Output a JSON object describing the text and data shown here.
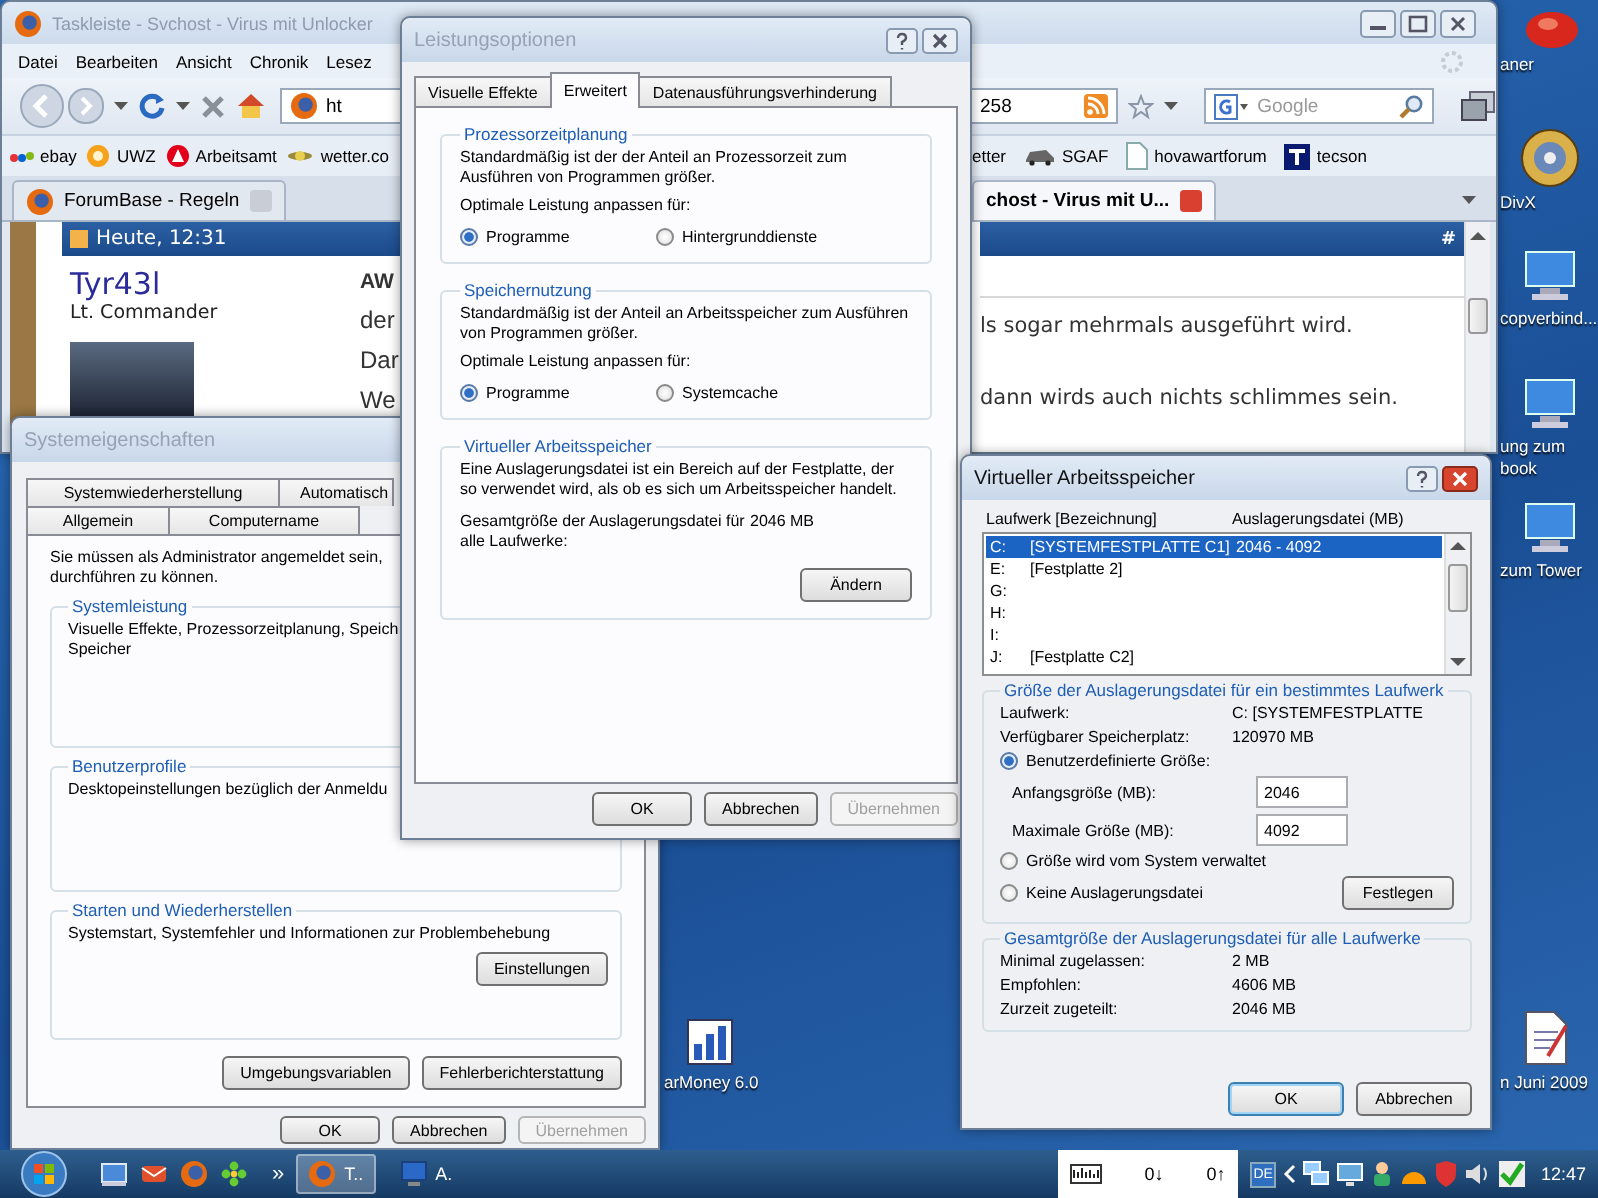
{
  "desktop": {
    "icons": [
      {
        "label": "aner",
        "kind": "red"
      },
      {
        "label": "DivX",
        "kind": "disc"
      },
      {
        "label": "copverbind...",
        "kind": "computer"
      },
      {
        "label": "ung zum book",
        "kind": "computer"
      },
      {
        "label": "zum Tower",
        "kind": "computer"
      },
      {
        "label": "arMoney 6.0",
        "kind": "chart"
      },
      {
        "label": "n Juni 2009",
        "kind": "document"
      }
    ]
  },
  "browser": {
    "title": "Taskleiste - Svchost - Virus mit Unlocker",
    "menu": [
      "Datei",
      "Bearbeiten",
      "Ansicht",
      "Chronik",
      "Lesez"
    ],
    "address_start": "ht",
    "address_end": "258",
    "search": {
      "placeholder": "Google"
    },
    "bookmarks_left": [
      {
        "label": "ebay",
        "kind": "ebay"
      },
      {
        "label": "UWZ",
        "kind": "circle"
      },
      {
        "label": "Arbeitsamt",
        "kind": "red-logo"
      },
      {
        "label": "wetter.co",
        "kind": "weather"
      }
    ],
    "bookmarks_right": [
      {
        "label": "etter",
        "kind": "none"
      },
      {
        "label": "SGAF",
        "kind": "car"
      },
      {
        "label": "hovawartforum",
        "kind": "page"
      },
      {
        "label": "tecson",
        "kind": "t-logo"
      }
    ],
    "tabs": [
      {
        "label": "ForumBase - Regeln",
        "selected": false
      },
      {
        "label": "chost - Virus mit U...",
        "selected": true
      }
    ],
    "post": {
      "date": "Heute, 12:31",
      "anchor": "#",
      "author": "Tyr43l",
      "rank": "Lt. Commander",
      "text_left": [
        "AW",
        "der",
        "Dar",
        "We"
      ],
      "text_right": [
        "ls sogar mehrmals ausgeführt wird.",
        "dann wirds auch nichts schlimmes sein."
      ]
    }
  },
  "system_properties": {
    "title": "Systemeigenschaften",
    "tab_rows": [
      [
        {
          "label": "Systemwiederherstellung",
          "selected": false
        },
        {
          "label": "Automatisch",
          "selected": false
        }
      ],
      [
        {
          "label": "Allgemein",
          "selected": false
        },
        {
          "label": "Computername",
          "selected": false
        }
      ]
    ],
    "intro_lines": [
      "Sie müssen als Administrator angemeldet sein,",
      "durchführen zu können."
    ],
    "groups": [
      {
        "title": "Systemleistung",
        "lines": [
          "Visuelle Effekte, Prozessorzeitplanung, Speich",
          "Speicher"
        ]
      },
      {
        "title": "Benutzerprofile",
        "lines": [
          "Desktopeinstellungen bezüglich der Anmeldu"
        ]
      },
      {
        "title": "Starten und Wiederherstellen",
        "lines": [
          "Systemstart, Systemfehler und Informationen zur Problembehebung"
        ],
        "button": "Einstellungen"
      }
    ],
    "extra_buttons": [
      "Umgebungsvariablen",
      "Fehlerberichterstattung"
    ],
    "buttons": [
      {
        "label": "OK",
        "disabled": false
      },
      {
        "label": "Abbrechen",
        "disabled": false
      },
      {
        "label": "Übernehmen",
        "disabled": true
      }
    ]
  },
  "performance_options": {
    "title": "Leistungsoptionen",
    "tabs": [
      {
        "label": "Visuelle Effekte",
        "selected": false
      },
      {
        "label": "Erweitert",
        "selected": true
      },
      {
        "label": "Datenausführungsverhinderung",
        "selected": false
      }
    ],
    "groups": [
      {
        "title": "Prozessorzeitplanung",
        "text": "Standardmäßig ist der der Anteil an Prozessorzeit zum Ausführen von Programmen größer.",
        "prompt": "Optimale Leistung anpassen für:",
        "options": [
          {
            "label": "Programme",
            "selected": true
          },
          {
            "label": "Hintergrunddienste",
            "selected": false
          }
        ]
      },
      {
        "title": "Speichernutzung",
        "text": "Standardmäßig ist der Anteil an Arbeitsspeicher zum Ausführen von Programmen größer.",
        "prompt": "Optimale Leistung anpassen für:",
        "options": [
          {
            "label": "Programme",
            "selected": true
          },
          {
            "label": "Systemcache",
            "selected": false
          }
        ]
      }
    ],
    "virtual_memory": {
      "title": "Virtueller Arbeitsspeicher",
      "text": "Eine Auslagerungsdatei ist ein Bereich auf der Festplatte, der so verwendet wird, als ob es sich um Arbeitsspeicher handelt.",
      "total_label": "Gesamtgröße der Auslagerungsdatei für alle Laufwerke:",
      "total_value": "2046 MB",
      "button": "Ändern"
    },
    "buttons": [
      {
        "label": "OK",
        "disabled": false
      },
      {
        "label": "Abbrechen",
        "disabled": false
      },
      {
        "label": "Übernehmen",
        "disabled": true
      }
    ]
  },
  "virtual_memory_dialog": {
    "title": "Virtueller Arbeitsspeicher",
    "columns": [
      "Laufwerk [Bezeichnung]",
      "Auslagerungsdatei (MB)"
    ],
    "drives": [
      {
        "letter": "C:",
        "label": "[SYSTEMFESTPLATTE C1]",
        "size": "2046 - 4092",
        "selected": true
      },
      {
        "letter": "E:",
        "label": "[Festplatte 2]",
        "selected": false
      },
      {
        "letter": "G:",
        "selected": false
      },
      {
        "letter": "H:",
        "selected": false
      },
      {
        "letter": "I:",
        "selected": false
      },
      {
        "letter": "J:",
        "label": "[Festplatte C2]",
        "selected": false
      }
    ],
    "group_title": "Größe der Auslagerungsdatei für ein bestimmtes Laufwerk",
    "drive_label": "Laufwerk:",
    "drive_value": "C:  [SYSTEMFESTPLATTE",
    "space_label": "Verfügbarer Speicherplatz:",
    "space_value": "120970 MB",
    "size_options": [
      {
        "label": "Benutzerdefinierte Größe:",
        "selected": true
      },
      {
        "label": "Größe wird vom System verwaltet",
        "selected": false
      },
      {
        "label": "Keine Auslagerungsdatei",
        "selected": false
      }
    ],
    "initial_label": "Anfangsgröße (MB):",
    "initial_value": "2046",
    "max_label": "Maximale Größe (MB):",
    "max_value": "4092",
    "set_button": "Festlegen",
    "total_title": "Gesamtgröße der Auslagerungsdatei für alle Laufwerke",
    "totals": [
      {
        "label": "Minimal zugelassen:",
        "value": "2 MB"
      },
      {
        "label": "Empfohlen:",
        "value": "4606 MB"
      },
      {
        "label": "Zurzeit zugeteilt:",
        "value": "2046 MB"
      }
    ],
    "buttons": [
      "OK",
      "Abbrechen"
    ]
  },
  "taskbar": {
    "overflow": "»",
    "quick_launch": [
      {
        "kind": "desktop"
      },
      {
        "kind": "mail"
      },
      {
        "kind": "globe"
      },
      {
        "kind": "flower"
      }
    ],
    "tasks": [
      {
        "label": "T..",
        "kind": "globe",
        "selected": true
      },
      {
        "label": "A.",
        "kind": "computer",
        "selected": false
      }
    ],
    "net_down": "0↓",
    "net_up": "0↑",
    "language": "DE",
    "clock": "12:47"
  }
}
